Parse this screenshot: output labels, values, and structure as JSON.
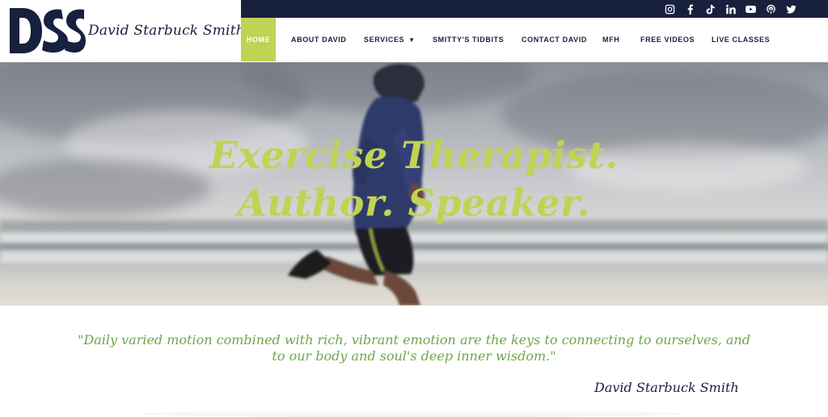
{
  "logo": {
    "initials": "DSS",
    "name": "David Starbuck Smith"
  },
  "social": [
    {
      "icon": "instagram-icon"
    },
    {
      "icon": "facebook-icon"
    },
    {
      "icon": "tiktok-icon"
    },
    {
      "icon": "linkedin-icon"
    },
    {
      "icon": "youtube-icon"
    },
    {
      "icon": "podcast-icon"
    },
    {
      "icon": "twitter-icon"
    }
  ],
  "nav": {
    "home": "HOME",
    "about": "ABOUT DAVID",
    "services": "SERVICES",
    "tidbits": "SMITTY'S TIDBITS",
    "contact": "CONTACT DAVID",
    "mfh": "MFH",
    "videos": "FREE VIDEOS",
    "classes": "LIVE CLASSES"
  },
  "hero": {
    "line1": "Exercise Therapist.",
    "line2": "Author. Speaker."
  },
  "quote": {
    "line1": "\"Daily varied motion combined with rich, vibrant emotion are the keys to connecting to ourselves, and",
    "line2": "to our body and soul's deep inner wisdom.\"",
    "attribution": "David Starbuck Smith"
  },
  "colors": {
    "navy": "#17213e",
    "accent_green": "#bfd354",
    "quote_green": "#6ea64a"
  }
}
